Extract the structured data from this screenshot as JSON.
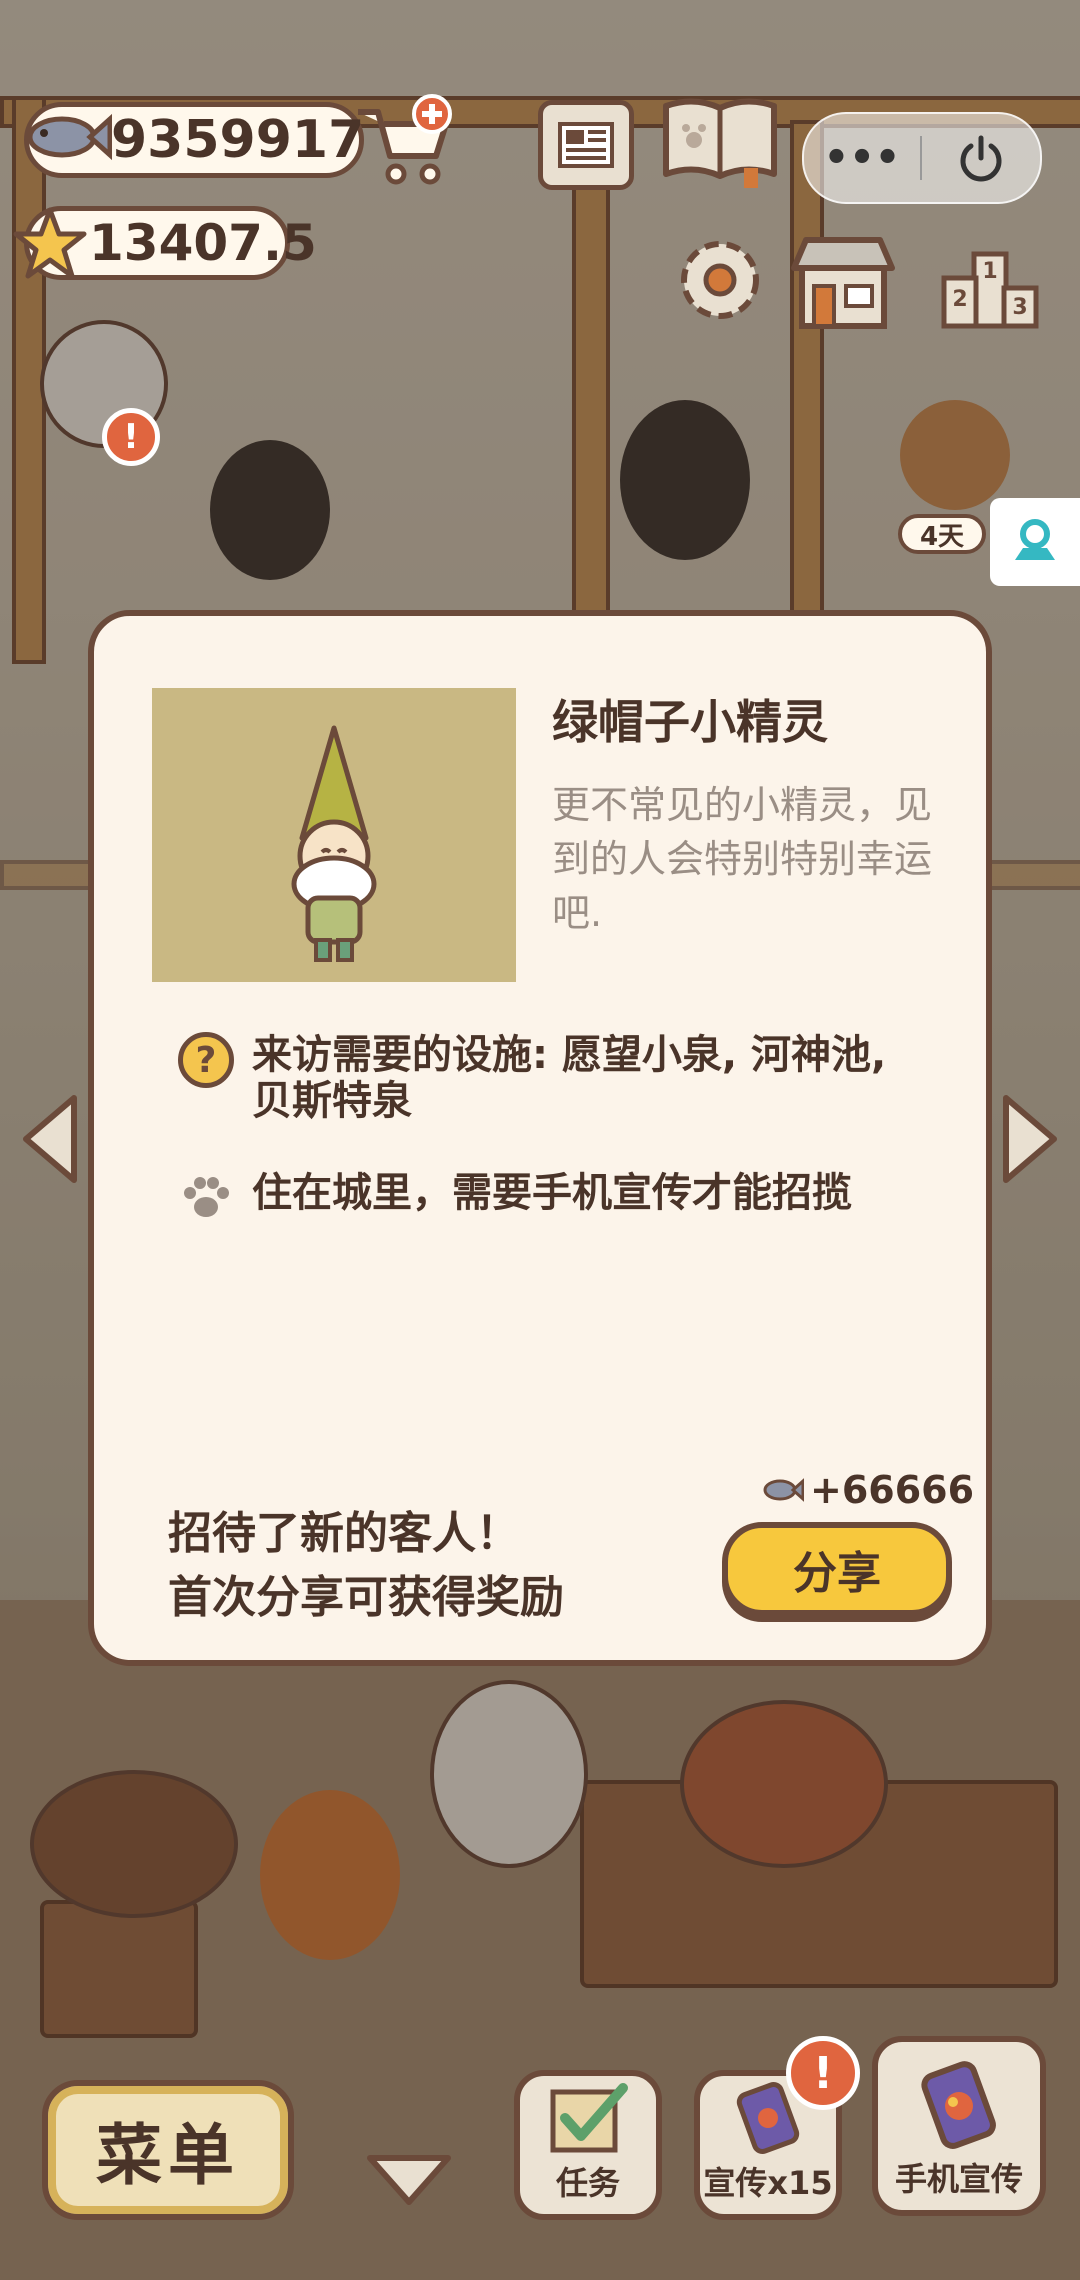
{
  "hud": {
    "fish_count": "9359917",
    "star_count": "13407.5",
    "icons": [
      "fish-icon",
      "cart-plus-icon",
      "star-icon",
      "newspaper-icon",
      "book-paw-icon",
      "settings-gear-icon",
      "shop-icon",
      "ranking-podium-icon"
    ],
    "mini_program": {
      "more_label": "•••",
      "power_icon": "power-icon"
    }
  },
  "scene": {
    "days_badge": "4天"
  },
  "dialog": {
    "name": "绿帽子小精灵",
    "description": "更不常见的小精灵，见到的人会特别特别幸运吧.",
    "requirements": [
      {
        "icon": "question-icon",
        "text": "来访需要的设施: 愿望小泉, 河神池, 贝斯特泉"
      },
      {
        "icon": "paw-icon",
        "text": "住在城里，需要手机宣传才能招揽"
      }
    ],
    "footer_line1": "招待了新的客人！",
    "footer_line2": "首次分享可获得奖励",
    "reward": "+66666",
    "share_label": "分享"
  },
  "bottom_bar": {
    "menu_label": "菜单",
    "task_label": "任务",
    "promote_x15_label": "宣传x15",
    "phone_promote_label": "手机宣传",
    "alert_mark": "!"
  },
  "colors": {
    "outline": "#6b4a3a",
    "dialog_bg": "#fcf4ea",
    "accent_yellow": "#f7c83d",
    "text_dark": "#4a3429",
    "text_muted": "#9a8e85",
    "alert_red": "#e0653f",
    "portrait_bg": "#c9b883"
  }
}
